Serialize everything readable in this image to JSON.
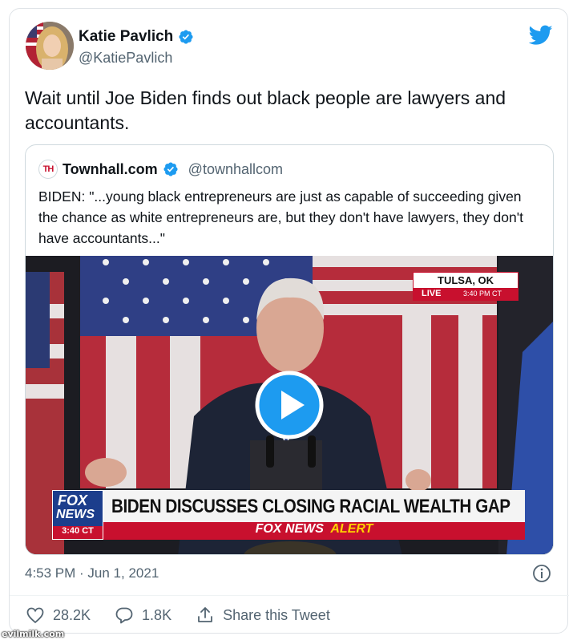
{
  "tweet": {
    "author": {
      "name": "Katie Pavlich",
      "handle": "@KatiePavlich",
      "verified": true
    },
    "text": "Wait until Joe Biden finds out black people are lawyers and accountants.",
    "quoted": {
      "logo": "TH",
      "name": "Townhall.com",
      "handle": "@townhallcom",
      "verified": true,
      "text": "BIDEN: \"...young black entrepreneurs are just as capable of succeeding given the chance as white entrepreneurs are, but they don't have lawyers, they don't have accountants...\"",
      "video": {
        "location": "TULSA, OK",
        "live_label": "LIVE",
        "live_time": "3:40 PM CT",
        "lower_third": "BIDEN DISCUSSES CLOSING RACIAL WEALTH GAP",
        "network_top": "FOX",
        "network_bottom": "NEWS",
        "bug_time": "3:40 CT",
        "alert_network": "FOX NEWS",
        "alert_word": "ALERT"
      }
    },
    "timestamp": "4:53 PM · Jun 1, 2021",
    "likes": "28.2K",
    "replies": "1.8K",
    "share_label": "Share this Tweet"
  },
  "colors": {
    "twitter_blue": "#1d9bf0",
    "text_secondary": "#536471",
    "fox_red": "#c8102e"
  },
  "icons": [
    "verified-badge-icon",
    "twitter-bird-icon",
    "play-icon",
    "info-icon",
    "heart-icon",
    "reply-icon",
    "share-icon"
  ],
  "watermark": "evilmilk.com"
}
